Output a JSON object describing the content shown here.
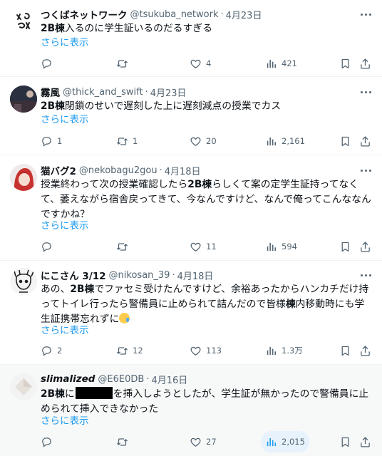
{
  "show_more_label": "さらに表示",
  "tweets": [
    {
      "name": "つくばネットワーク",
      "handle": "@tsukuba_network",
      "date": "4月23日",
      "body_bold": "2B棟",
      "body_rest": "入るのに学生証いるのだるすぎる",
      "replies": "",
      "retweets": "",
      "likes": "4",
      "views": "421"
    },
    {
      "name": "霧風",
      "handle": "@thick_and_swift",
      "date": "4月23日",
      "body_bold": "2B棟",
      "body_rest": "閉鎖のせいで遅刻した上に遅刻減点の授業でカス",
      "replies": "1",
      "retweets": "1",
      "likes": "20",
      "views": "2,161"
    },
    {
      "name": "猫バグ2",
      "handle": "@nekobagu2gou",
      "date": "4月18日",
      "body_pre": "授業終わって次の授業確認したら",
      "body_bold": "2B棟",
      "body_rest": "らしくて案の定学生証持ってなくて、萎えながら宿舎戻ってきて、今なんですけど、なんで俺ってこんななんですかね？",
      "replies": "",
      "retweets": "",
      "likes": "11",
      "views": "594"
    },
    {
      "name": "にこさん 3/12",
      "handle": "@nikosan_39",
      "date": "4月18日",
      "body_pre": "あの、",
      "body_bold": "2B棟",
      "body_rest": "でファセミ受けたんですけど、余裕あったからハンカチだけ持ってトイレ行ったら警備員に止められて詰んだので皆様",
      "body_bold2": "棟",
      "body_rest2": "内移動時にも学生証携帯忘れずに",
      "replies": "2",
      "retweets": "12",
      "likes": "113",
      "views": "1.3万"
    },
    {
      "name": "slimalized",
      "handle": "@E6E0DB",
      "date": "4月16日",
      "body_bold": "2B棟",
      "body_mid": "に",
      "body_rest": "を挿入しようとしたが、学生証が無かったので警備員に止められて挿入できなかった",
      "replies": "",
      "retweets": "",
      "likes": "27",
      "views": "2,015"
    }
  ],
  "colors": {
    "link": "#1d9bf0",
    "muted": "#536471",
    "text": "#0f1419",
    "divider": "#eff3f4"
  }
}
